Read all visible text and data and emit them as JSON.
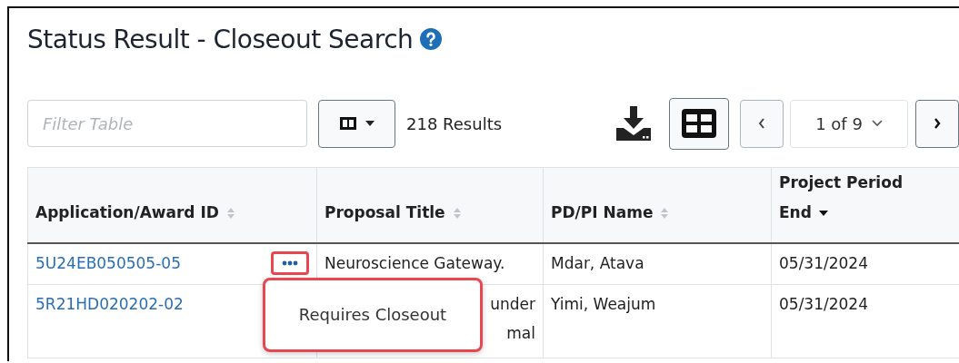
{
  "title": "Status Result - Closeout Search",
  "toolbar": {
    "filter_placeholder": "Filter Table",
    "results": "218 Results",
    "page": "1 of 9"
  },
  "table": {
    "columns": [
      {
        "label": "Application/Award ID",
        "sorted": false
      },
      {
        "label": "Proposal Title",
        "sorted": false
      },
      {
        "label": "PD/PI Name",
        "sorted": false
      },
      {
        "label": "Project Period End",
        "sorted": true
      }
    ],
    "rows": [
      {
        "id": "5U24EB050505-05",
        "title_lines": [
          "Neuroscience Gateway."
        ],
        "pi": "Mdar, Atava",
        "end": "05/31/2024",
        "menu_open": true
      },
      {
        "id": "5R21HD020202-02",
        "title_lines": [
          "under",
          "mal"
        ],
        "pi": "Yimi, Weajum",
        "end": "05/31/2024",
        "menu_open": false
      }
    ]
  },
  "popover": {
    "items": [
      "Requires Closeout"
    ]
  }
}
